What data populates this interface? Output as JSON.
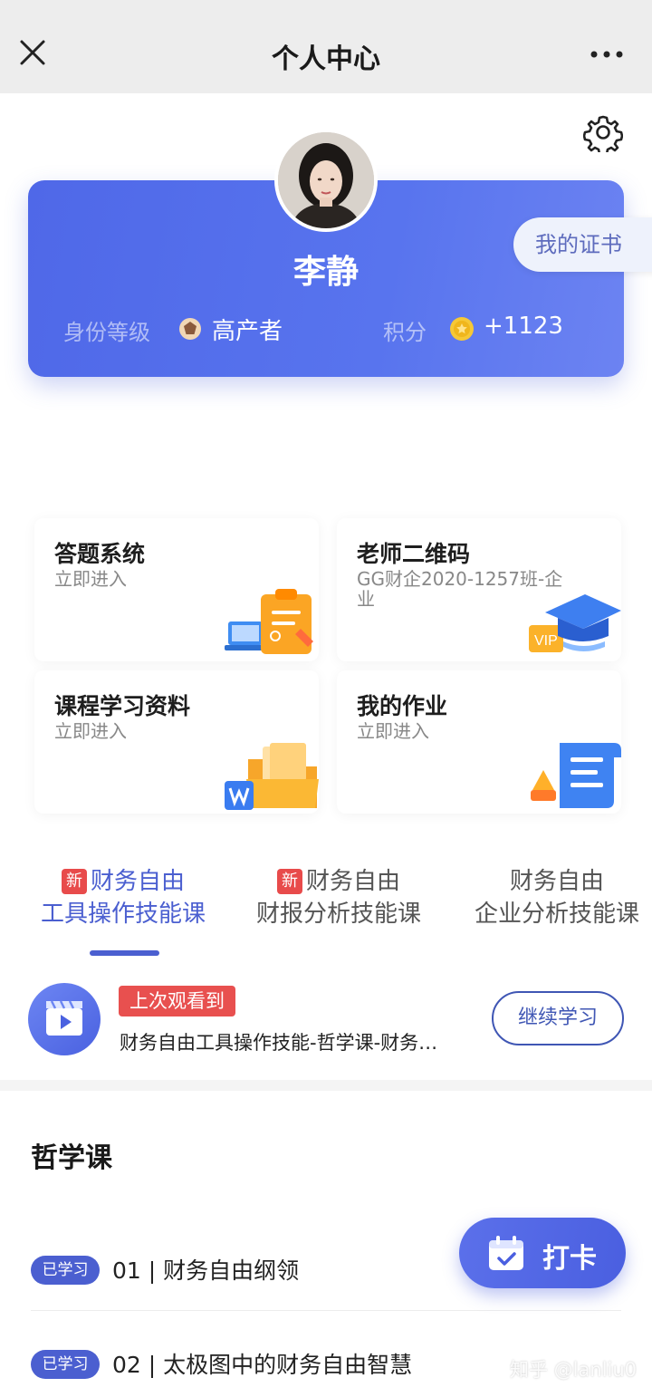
{
  "header": {
    "title": "个人中心",
    "close_icon": "close-icon",
    "more_icon": "more-icon"
  },
  "profile": {
    "name": "李静",
    "certificate_label": "我的证书",
    "level_label": "身份等级",
    "level_value": "高产者",
    "points_label": "积分",
    "points_value": "+1123",
    "accent": "#5068e8"
  },
  "tiles": [
    {
      "title": "答题系统",
      "subtitle": "立即进入",
      "icon": "quiz-clipboard-icon"
    },
    {
      "title": "老师二维码",
      "subtitle": "GG财企2020-1257班-企业",
      "icon": "vip-graduation-cap-icon"
    },
    {
      "title": "课程学习资料",
      "subtitle": "立即进入",
      "icon": "folder-document-icon"
    },
    {
      "title": "我的作业",
      "subtitle": "立即进入",
      "icon": "homework-scroll-icon"
    }
  ],
  "tabs": [
    {
      "badge": "新",
      "line1": "财务自由",
      "line2": "工具操作技能课"
    },
    {
      "badge": "新",
      "line1": "财务自由",
      "line2": "财报分析技能课"
    },
    {
      "line1": "财务自由",
      "line2": "企业分析技能课"
    }
  ],
  "resume": {
    "badge": "上次观看到",
    "title": "财务自由工具操作技能-哲学课-财务…",
    "button": "继续学习"
  },
  "section": {
    "title": "哲学课"
  },
  "lessons": [
    {
      "badge": "已学习",
      "title": "01 | 财务自由纲领"
    },
    {
      "badge": "已学习",
      "title": "02 | 太极图中的财务自由智慧"
    }
  ],
  "checkin": {
    "label": "打卡"
  },
  "watermark": "知乎 @lanliu0"
}
